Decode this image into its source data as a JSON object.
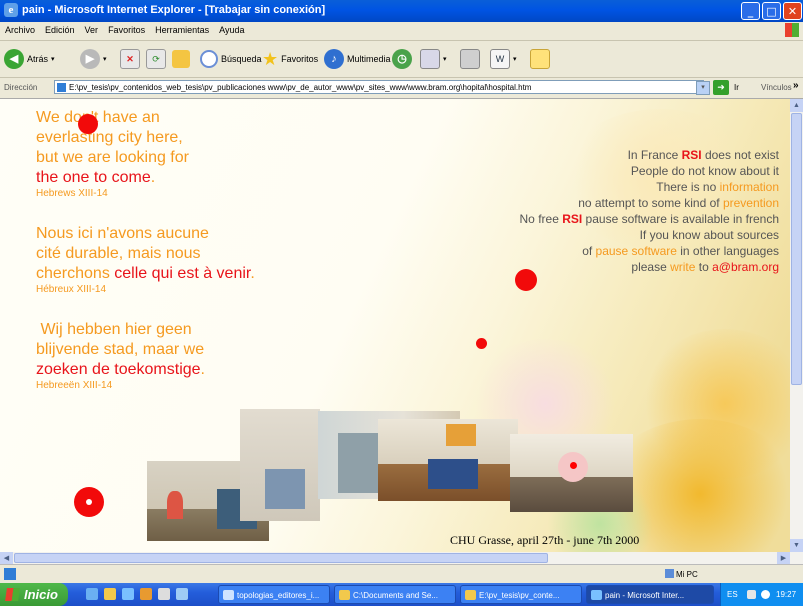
{
  "window": {
    "title": "pain - Microsoft Internet Explorer - [Trabajar sin conexión]",
    "controls": {
      "minimize": "_",
      "maximize": "□",
      "close": "✕"
    }
  },
  "menu": [
    "Archivo",
    "Edición",
    "Ver",
    "Favoritos",
    "Herramientas",
    "Ayuda"
  ],
  "toolbar": {
    "back_label": "Atrás",
    "search_label": "Búsqueda",
    "favorites_label": "Favoritos",
    "multimedia_label": "Multimedia"
  },
  "address": {
    "label": "Dirección",
    "value": "E:\\pv_tesis\\pv_contenidos_web_tesis\\pv_publicaciones www\\pv_de_autor_www\\pv_sites_www\\www.bram.org\\hopital\\hospital.htm",
    "go_label": "Ir",
    "links_label": "Vínculos",
    "more_label": "»"
  },
  "page": {
    "verse_en": {
      "line1": "We don't have an",
      "line2": "everlasting city here,",
      "line3": "but we are looking for",
      "line4a": "the one to come",
      "line4b": ".",
      "ref": "Hebrews XIII-14"
    },
    "verse_fr": {
      "line1": "Nous ici n'avons aucune",
      "line2": "cité durable, mais nous",
      "line3a": "cherchons ",
      "line3b": "celle qui est à venir",
      "line3c": ".",
      "ref": "Hébreux XIII-14"
    },
    "verse_nl": {
      "line1": " Wij hebben hier geen",
      "line2": "blijvende stad, maar we",
      "line3a": "zoeken de toekomstige",
      "line3b": ".",
      "ref": "Hebreeën XIII-14"
    },
    "rsi": {
      "l1a": "In France ",
      "l1b": "RSI",
      "l1c": " does not exist",
      "l2": "People do not know about it",
      "l3a": "There is no ",
      "l3b": "information",
      "l4a": "no attempt to some kind of ",
      "l4b": "prevention",
      "l5a": "No free ",
      "l5b": "RSI",
      "l5c": " pause software is available in french",
      "l6": "If you know about sources",
      "l7a": "of ",
      "l7b": "pause software",
      "l7c": " in other languages",
      "l8a": "please ",
      "l8b": "write",
      "l8c": " to ",
      "l8d": "a@bram.org"
    },
    "caption": "CHU Grasse, april 27th - june 7th 2000"
  },
  "status": {
    "zone": "Mi PC"
  },
  "taskbar": {
    "start": "Inicio",
    "tasks": [
      "topologias_editores_i...",
      "C:\\Documents and Se...",
      "E:\\pv_tesis\\pv_conte...",
      "pain - Microsoft Inter..."
    ],
    "lang": "ES",
    "clock": "19:27"
  },
  "colors": {
    "accent_red": "#e8141a",
    "accent_orange": "#f59a20",
    "xp_blue": "#0054e3"
  }
}
